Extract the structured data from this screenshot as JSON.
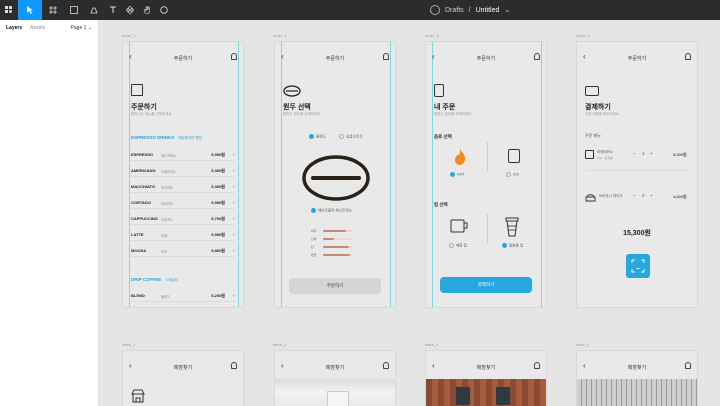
{
  "toolbar": {
    "file_path_prefix": "Drafts",
    "separator": "/",
    "file_name": "Untitled",
    "chevron": "⌄"
  },
  "left_panel": {
    "tab_layers": "Layers",
    "tab_assets": "Assets",
    "page_label": "Page 1",
    "page_chevron": "⌄"
  },
  "frames": {
    "order_1": {
      "label": "order_1",
      "title": "주문하기",
      "heading": "주문하기",
      "subtitle": "원하시는 메뉴를 선택하세요",
      "section_espresso": "ESPRESSO DRINKS",
      "section_espresso_note": "매장에서만 판매 ·",
      "items": [
        {
          "name": "ESPRESSO",
          "sub": "에스프레소",
          "price": "5,000원"
        },
        {
          "name": "AMERICANO",
          "sub": "아메리카노",
          "price": "5,300원"
        },
        {
          "name": "MACCHIATO",
          "sub": "마끼아또",
          "price": "5,300원"
        },
        {
          "name": "CORTADO",
          "sub": "코르타도",
          "price": "5,500원"
        },
        {
          "name": "CAPPUCCINO",
          "sub": "카푸치노",
          "price": "5,700원"
        },
        {
          "name": "LATTE",
          "sub": "라떼",
          "price": "5,500원"
        },
        {
          "name": "MOCHA",
          "sub": "모카",
          "price": "5,800원"
        }
      ],
      "section_drip": "DRIP COFFEE",
      "section_drip_note": "스페셜티",
      "drip_item": {
        "name": "BLEND",
        "sub": "블렌드",
        "price": "5,200원"
      },
      "plus": "+"
    },
    "order_2": {
      "label": "order_2",
      "title": "주문하기",
      "heading": "원두 선택",
      "subtitle": "원하는 원두를 선택하세요",
      "option_a": "블렌드",
      "option_b": "싱글오리진",
      "bean_name": "헤이즈블라 헤스트레소",
      "profile": [
        {
          "label": "바디",
          "value": 0.75
        },
        {
          "label": "산미",
          "value": 0.35
        },
        {
          "label": "단",
          "value": 0.85
        },
        {
          "label": "쓴맛",
          "value": 0.9
        }
      ],
      "button": "주문하기"
    },
    "order_3": {
      "label": "order_3",
      "title": "주문하기",
      "heading": "내 주문",
      "subtitle": "원하는 옵션을 선택하세요",
      "sec_temp": "음료 선택",
      "hot": "HOT",
      "ice": "ICE",
      "sec_cup": "컵 선택",
      "cup_store": "매장 컵",
      "cup_togo": "일회용 컵",
      "button": "결제하기"
    },
    "order_4": {
      "label": "order_4",
      "title": "주문하기",
      "heading": "결제하기",
      "subtitle": "주문 내용을 확인하세요",
      "sec": "주문 메뉴",
      "line1": {
        "name": "아메리카노",
        "detail": "ICE · 일회용",
        "qty": "1",
        "price": "5,300원"
      },
      "line2": {
        "name": "브라우니 케이크",
        "qty": "2",
        "price": "4,600원"
      },
      "minus": "−",
      "plus": "+",
      "total": "15,300원"
    },
    "store": [
      {
        "label": "store_1",
        "title": "매장찾기"
      },
      {
        "label": "store_2",
        "title": "매장찾기"
      },
      {
        "label": "store_3",
        "title": "매장찾기"
      },
      {
        "label": "store_4",
        "title": "매장찾기"
      }
    ]
  },
  "colors": {
    "accent": "#27a7e0",
    "toolbar": "#2c2c2c",
    "guide": "#7fd6e6",
    "hot": "#f08a24"
  }
}
